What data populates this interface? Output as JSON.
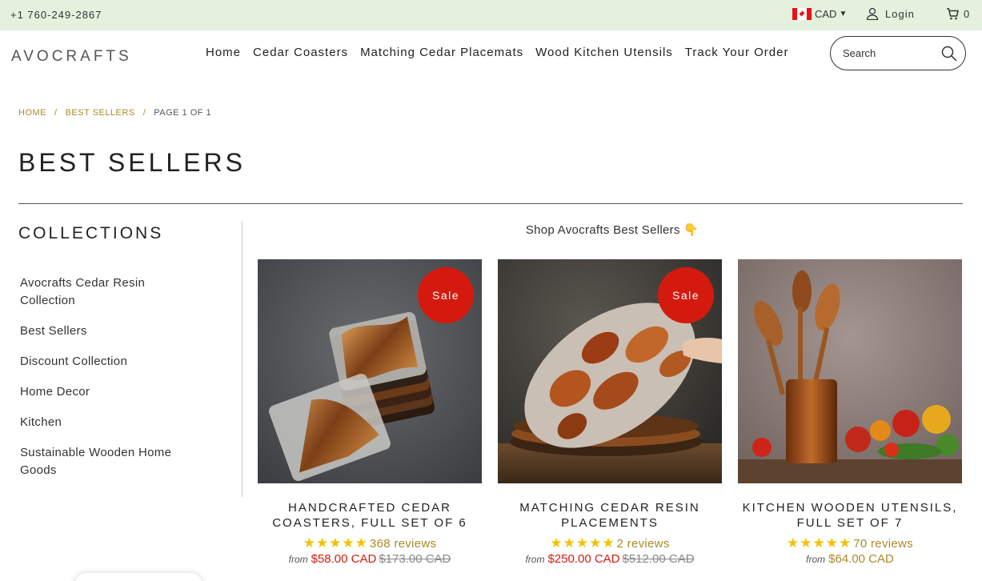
{
  "topbar": {
    "phone": "+1 760-249-2867",
    "currency": "CAD",
    "login_label": "Login",
    "cart_count": "0",
    "background": "#e4f1dd"
  },
  "header": {
    "logo": "AVOCRAFTS",
    "nav": [
      "Home",
      "Cedar Coasters",
      "Matching Cedar Placemats",
      "Wood Kitchen Utensils",
      "Track Your Order"
    ],
    "search_placeholder": "Search"
  },
  "breadcrumb": {
    "home": "HOME",
    "section": "BEST SELLERS",
    "current": "PAGE 1 OF 1",
    "separator": "/"
  },
  "page_title": "BEST SELLERS",
  "sidebar": {
    "title": "COLLECTIONS",
    "items": [
      "Avocrafts Cedar Resin Collection",
      "Best Sellers",
      "Discount Collection",
      "Home Decor",
      "Kitchen",
      "Sustainable Wooden Home Goods"
    ]
  },
  "main": {
    "intro": "Shop Avocrafts Best Sellers 👇",
    "products": [
      {
        "name": "HANDCRAFTED CEDAR COASTERS, FULL SET OF 6",
        "badge": "Sale",
        "stars": "★★★★★",
        "reviews": "368 reviews",
        "from": "from",
        "price": "$58.00 CAD",
        "compare_price": "$173.00 CAD"
      },
      {
        "name": "MATCHING CEDAR RESIN PLACEMENTS",
        "badge": "Sale",
        "stars": "★★★★★",
        "reviews": "2 reviews",
        "from": "from",
        "price": "$250.00 CAD",
        "compare_price": "$512.00 CAD"
      },
      {
        "name": "KITCHEN WOODEN UTENSILS, FULL SET OF 7",
        "stars": "★★★★★",
        "reviews": "70 reviews",
        "from": "from",
        "price": "$64.00 CAD"
      }
    ]
  },
  "colors": {
    "accent_gold": "#a98a28",
    "sale_red": "#d41a0f",
    "star_yellow": "#f2c200"
  }
}
